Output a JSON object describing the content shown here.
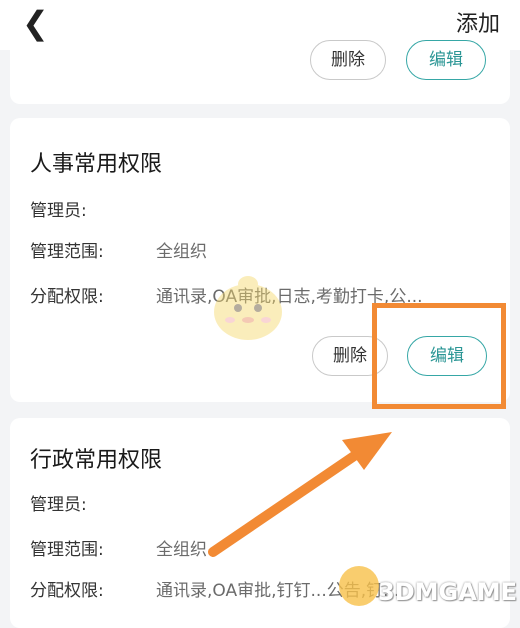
{
  "nav": {
    "back_glyph": "❮",
    "add_label": "添加"
  },
  "top_card": {
    "delete_label": "删除",
    "edit_label": "编辑"
  },
  "cards": [
    {
      "title": "人事常用权限",
      "admin_label": "管理员:",
      "admin_value": "",
      "scope_label": "管理范围:",
      "scope_value": "全组织",
      "perm_label": "分配权限:",
      "perm_value": "通讯录,OA审批,日志,考勤打卡,公...",
      "delete_label": "删除",
      "edit_label": "编辑"
    },
    {
      "title": "行政常用权限",
      "admin_label": "管理员:",
      "admin_value": "",
      "scope_label": "管理范围:",
      "scope_value": "全组织",
      "perm_label": "分配权限:",
      "perm_value": "通讯录,OA审批,钉钉...公告,钉..."
    }
  ],
  "annotation": {
    "highlight_color": "#f28a34",
    "arrow_color": "#f28a34"
  },
  "watermark": {
    "text": "3DMGAME",
    "icon": "mascot-icon"
  }
}
